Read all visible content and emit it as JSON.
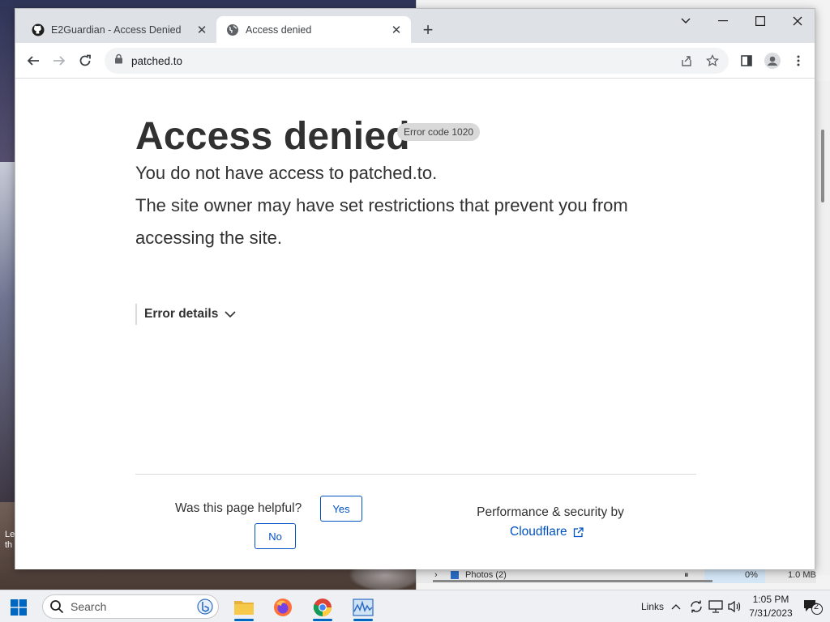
{
  "browser": {
    "tabs": [
      {
        "title": "E2Guardian - Access Denied",
        "icon": "github-icon",
        "active": false
      },
      {
        "title": "Access denied",
        "icon": "globe-icon",
        "active": true
      }
    ],
    "url": "patched.to"
  },
  "page": {
    "heading": "Access denied",
    "error_code": "Error code 1020",
    "line1": "You do not have access to patched.to.",
    "line2": "The site owner may have set restrictions that prevent you from",
    "line3": "accessing the site.",
    "error_details": "Error details",
    "helpful_question": "Was this page helpful?",
    "yes": "Yes",
    "no": "No",
    "performance": "Performance & security by",
    "provider": "Cloudflare",
    "link_color": "#0051c3"
  },
  "desktop": {
    "label_line1": "Le",
    "label_line2": "th"
  },
  "background_window": {
    "row_label": "Photos (2)",
    "row_pct": "0%",
    "row_mem": "1.0 MB"
  },
  "taskbar": {
    "search_placeholder": "Search",
    "links_label": "Links",
    "time": "1:05 PM",
    "date": "7/31/2023",
    "notification_count": "2",
    "accent": "#0067c0"
  }
}
